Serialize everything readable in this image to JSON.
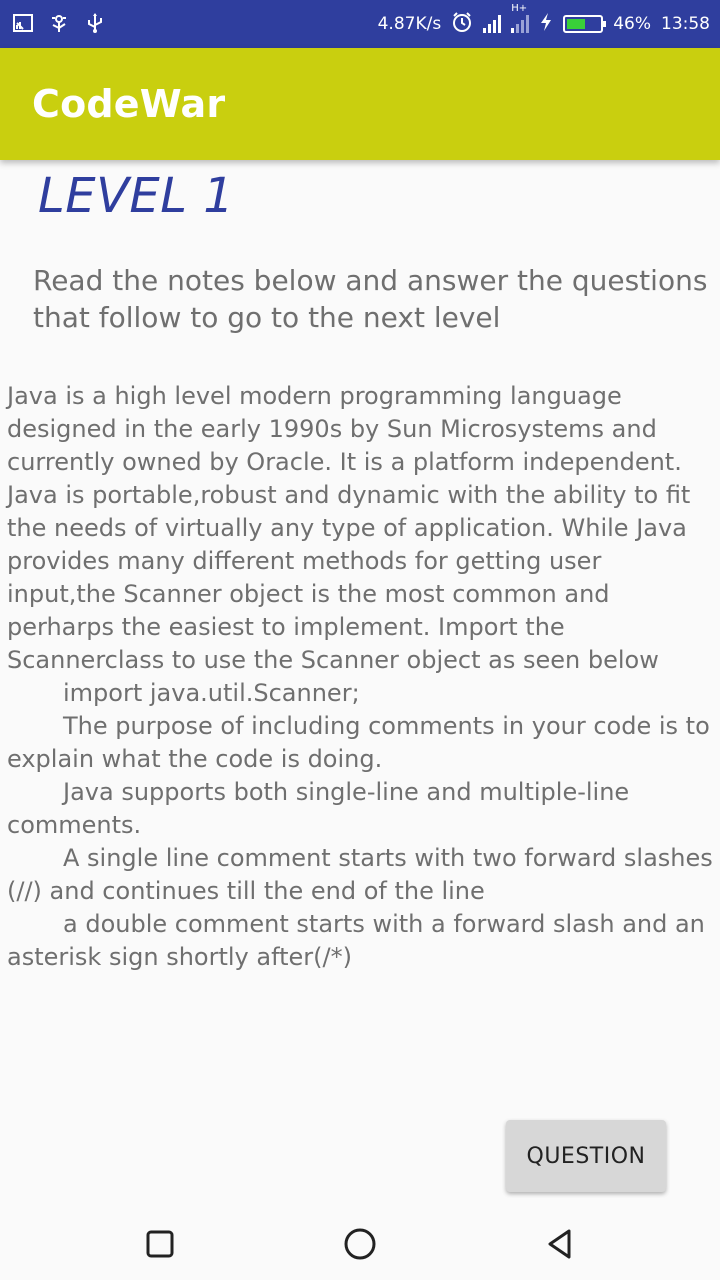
{
  "status_bar": {
    "speed": "4.87K/s",
    "network_type": "H+",
    "battery_percent": "46%",
    "time": "13:58",
    "battery_level": 0.46,
    "battery_color": "#39d039"
  },
  "app_bar": {
    "title": "CodeWar",
    "color": "#c9cf0f"
  },
  "level": {
    "title": "LEVEL 1"
  },
  "instructions": "Read the notes below and answer the questions that follow to go to the next level",
  "notes": {
    "p1": "Java is a high level modern programming language designed in the early 1990s by Sun Microsystems and currently owned by Oracle. It is a platform independent. Java is portable,robust and dynamic with the ability to fit the needs of virtually any type of application. While Java provides many different methods for getting user input,the Scanner object is the most common and perharps the easiest to implement. Import the Scannerclass to use the Scanner object as seen below",
    "p2": "import java.util.Scanner;",
    "p3": " The purpose of including comments in your code is to explain what the code is doing.",
    "p4": "Java supports both single-line and multiple-line comments.",
    "p5": "A single line comment starts with two forward slashes (//) and continues till the end of the line",
    "p6": "a double comment starts with a forward slash and an asterisk sign shortly after(/*)"
  },
  "question_button": {
    "label": "QUESTION"
  },
  "icons": {
    "cast": "cast-icon",
    "usb_debug": "usb-debug-icon",
    "usb": "usb-icon",
    "alarm": "alarm-icon",
    "signal1": "signal-icon",
    "signal2": "signal-icon",
    "charging": "charging-icon",
    "battery": "battery-icon",
    "recents": "recents-square-icon",
    "home": "home-circle-icon",
    "back": "back-triangle-icon"
  }
}
